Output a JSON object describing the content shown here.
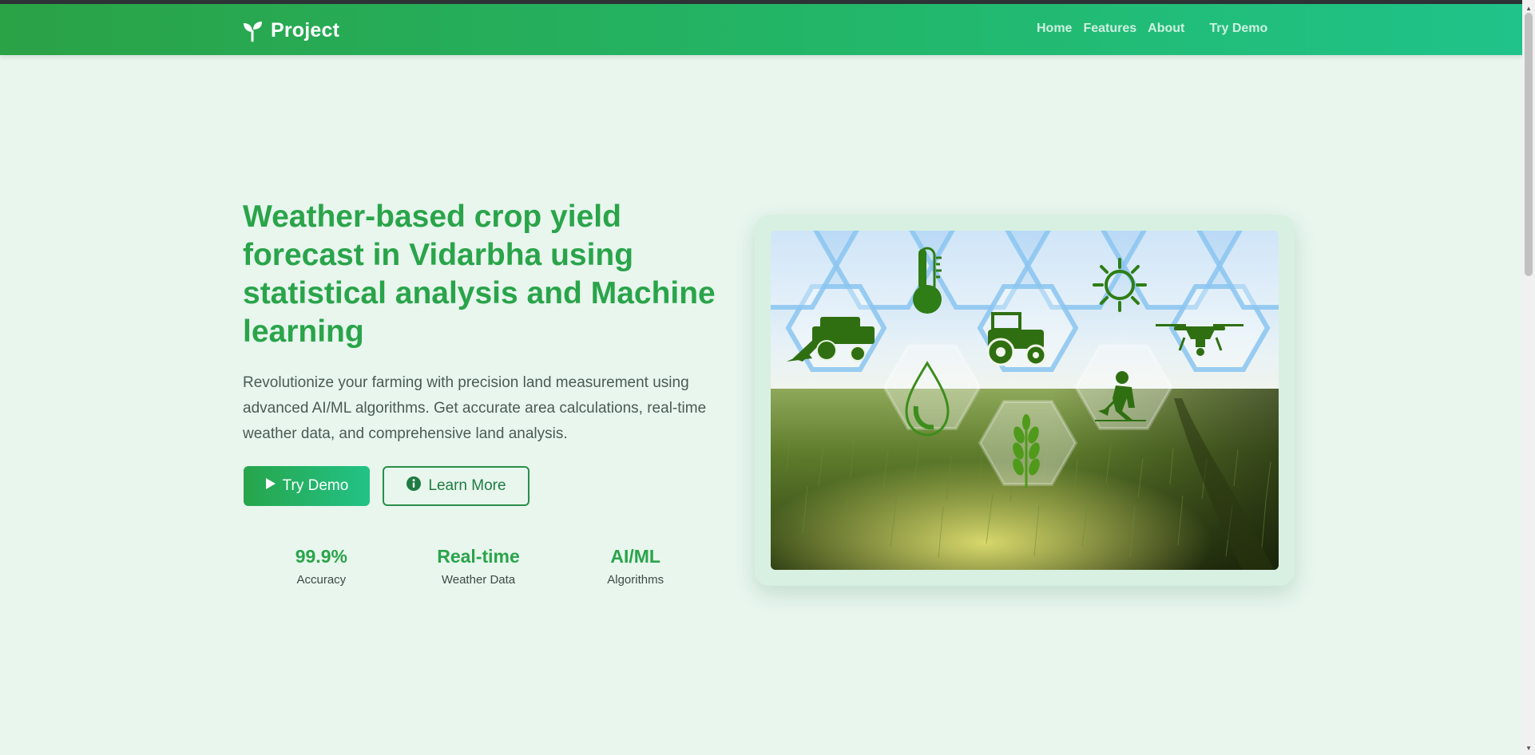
{
  "navbar": {
    "brand": "Project",
    "brand_icon": "sprout-icon",
    "links": [
      "Home",
      "Features",
      "About"
    ],
    "demo_link": "Try Demo"
  },
  "hero": {
    "title": "Weather-based crop yield forecast in Vidarbha using statistical analysis and Machine learning",
    "description": "Revolutionize your farming with precision land measurement using advanced AI/ML algorithms. Get accurate area calculations, real-time weather data, and comprehensive land analysis.",
    "primary_button": "Try Demo",
    "primary_icon": "play-icon",
    "secondary_button": "Learn More",
    "secondary_icon": "info-icon",
    "stats": [
      {
        "value": "99.9%",
        "label": "Accuracy"
      },
      {
        "value": "Real-time",
        "label": "Weather Data"
      },
      {
        "value": "AI/ML",
        "label": "Algorithms"
      }
    ]
  },
  "image": {
    "icons": [
      "harvester-icon",
      "thermometer-icon",
      "tractor-icon",
      "sun-icon",
      "drone-icon",
      "water-drop-icon",
      "wheat-icon",
      "farmer-icon"
    ]
  },
  "colors": {
    "nav_start": "#2aa246",
    "nav_end": "#20c38a",
    "accent": "#2aa44a",
    "background": "#e8f6ee"
  }
}
